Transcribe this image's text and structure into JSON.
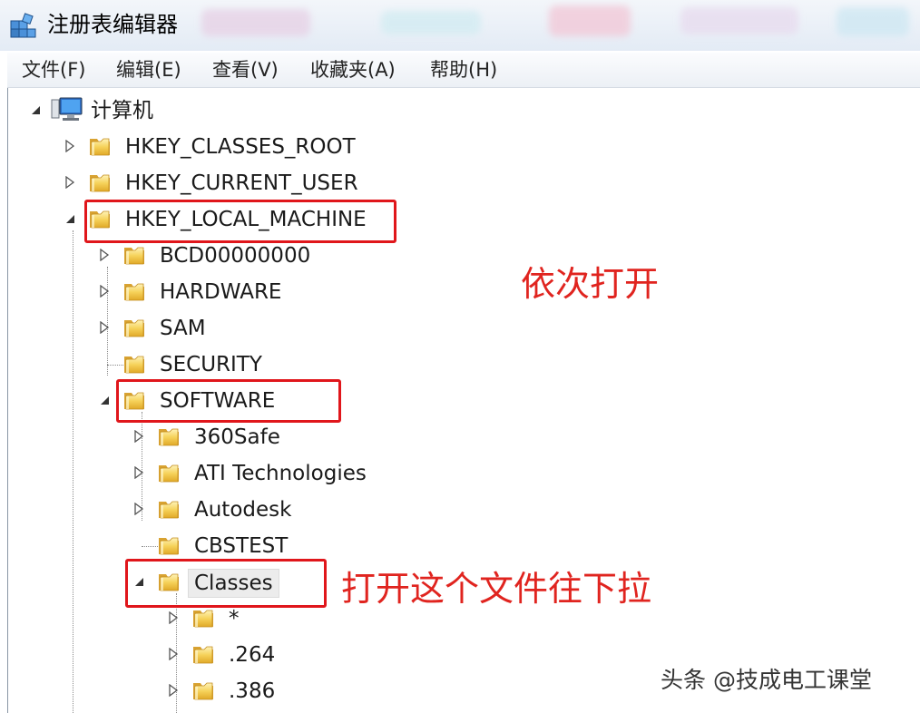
{
  "window": {
    "title": "注册表编辑器"
  },
  "menu": [
    {
      "id": "file",
      "label": "文件(F)"
    },
    {
      "id": "edit",
      "label": "编辑(E)"
    },
    {
      "id": "view",
      "label": "查看(V)"
    },
    {
      "id": "favorites",
      "label": "收藏夹(A)"
    },
    {
      "id": "help",
      "label": "帮助(H)"
    }
  ],
  "tree": {
    "root": "计算机",
    "hkcr": "HKEY_CLASSES_ROOT",
    "hkcu": "HKEY_CURRENT_USER",
    "hklm": "HKEY_LOCAL_MACHINE",
    "bcd": "BCD00000000",
    "hardware": "HARDWARE",
    "sam": "SAM",
    "security": "SECURITY",
    "software": "SOFTWARE",
    "safe360": "360Safe",
    "ati": "ATI Technologies",
    "autodesk": "Autodesk",
    "cbstest": "CBSTEST",
    "classes": "Classes",
    "star": "*",
    "ext264": ".264",
    "ext386": ".386"
  },
  "annotations": {
    "open_in_order": "依次打开",
    "open_and_scroll": "打开这个文件往下拉"
  },
  "watermark": "头条 @技成电工课堂",
  "colors": {
    "annotation": "#e0161b",
    "folder": "#f2c94c"
  }
}
